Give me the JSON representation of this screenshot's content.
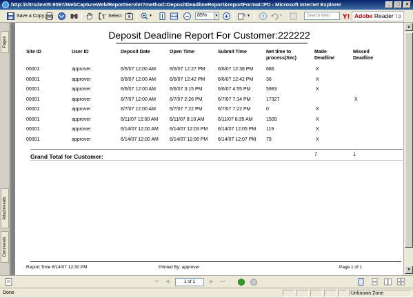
{
  "window": {
    "title": "http://cltrsdev05:9097/WebCaptureWeb/ReportServlet?method=DepositDeadlineReport&reportFormat=PD - Microsoft Internet Explorer",
    "controls": [
      "_",
      "□",
      "×"
    ]
  },
  "toolbar": {
    "save_copy_label": "Save a Copy",
    "select_label": "Select",
    "zoom_value": "85%",
    "search_placeholder": "Search Web",
    "adobe_brand": "Adobe",
    "adobe_product": "Reader",
    "adobe_version": "7.0"
  },
  "side_tabs": {
    "pages": "Pages",
    "attachments": "Attachments",
    "comments": "Comments"
  },
  "report": {
    "title": "Deposit Deadline Report For Customer:222222",
    "columns": [
      "Site ID",
      "User ID",
      "Deposit Date",
      "Open Time",
      "Submit Time",
      "Net time to process(Sec)",
      "Made Deadline",
      "Missed Deadline"
    ],
    "rows": [
      [
        "00001",
        "approver",
        "6/6/07 12:00 AM",
        "6/6/07 12:27 PM",
        "6/6/07 12:38 PM",
        "686",
        "X",
        ""
      ],
      [
        "00001",
        "approver",
        "6/6/07 12:00 AM",
        "6/6/07 12:42 PM",
        "6/6/07 12:42 PM",
        "36",
        "X",
        ""
      ],
      [
        "00001",
        "approver",
        "6/6/07 12:00 AM",
        "6/6/07 3:15 PM",
        "6/6/07 4:55 PM",
        "5983",
        "X",
        ""
      ],
      [
        "00001",
        "approver",
        "6/7/07 12:00 AM",
        "6/7/07 2:26 PM",
        "6/7/07 7:14 PM",
        "17327",
        "",
        "X"
      ],
      [
        "00001",
        "approver",
        "6/7/07 12:00 AM",
        "6/7/07 7:22 PM",
        "6/7/07 7:22 PM",
        "0",
        "X",
        ""
      ],
      [
        "00001",
        "approver",
        "6/11/07 12:00 AM",
        "6/11/07 8:10 AM",
        "6/11/07 8:35 AM",
        "1509",
        "X",
        ""
      ],
      [
        "00001",
        "approver",
        "6/14/07 12:00 AM",
        "6/14/07 12:03 PM",
        "6/14/07 12:05 PM",
        "119",
        "X",
        ""
      ],
      [
        "00001",
        "approver",
        "6/14/07 12:00 AM",
        "6/14/07 12:06 PM",
        "6/14/07 12:07 PM",
        "79",
        "X",
        ""
      ]
    ],
    "grand_total_label": "Grand Total for Customer:",
    "total_made": "7",
    "total_missed": "1",
    "footer": {
      "report_time": "Report Time  6/14/07 12:30 PM",
      "printed_by": "Printed By:  approver",
      "page_info": "Page 1 of 1"
    }
  },
  "navigation": {
    "page_indicator": "1 of 1"
  },
  "statusbar": {
    "status_text": "Done",
    "zone_text": "Unknown Zone"
  },
  "colors": {
    "titlebar": "#0a246a",
    "adobe_red": "#cc0000",
    "go_green": "#2e9d2e"
  }
}
